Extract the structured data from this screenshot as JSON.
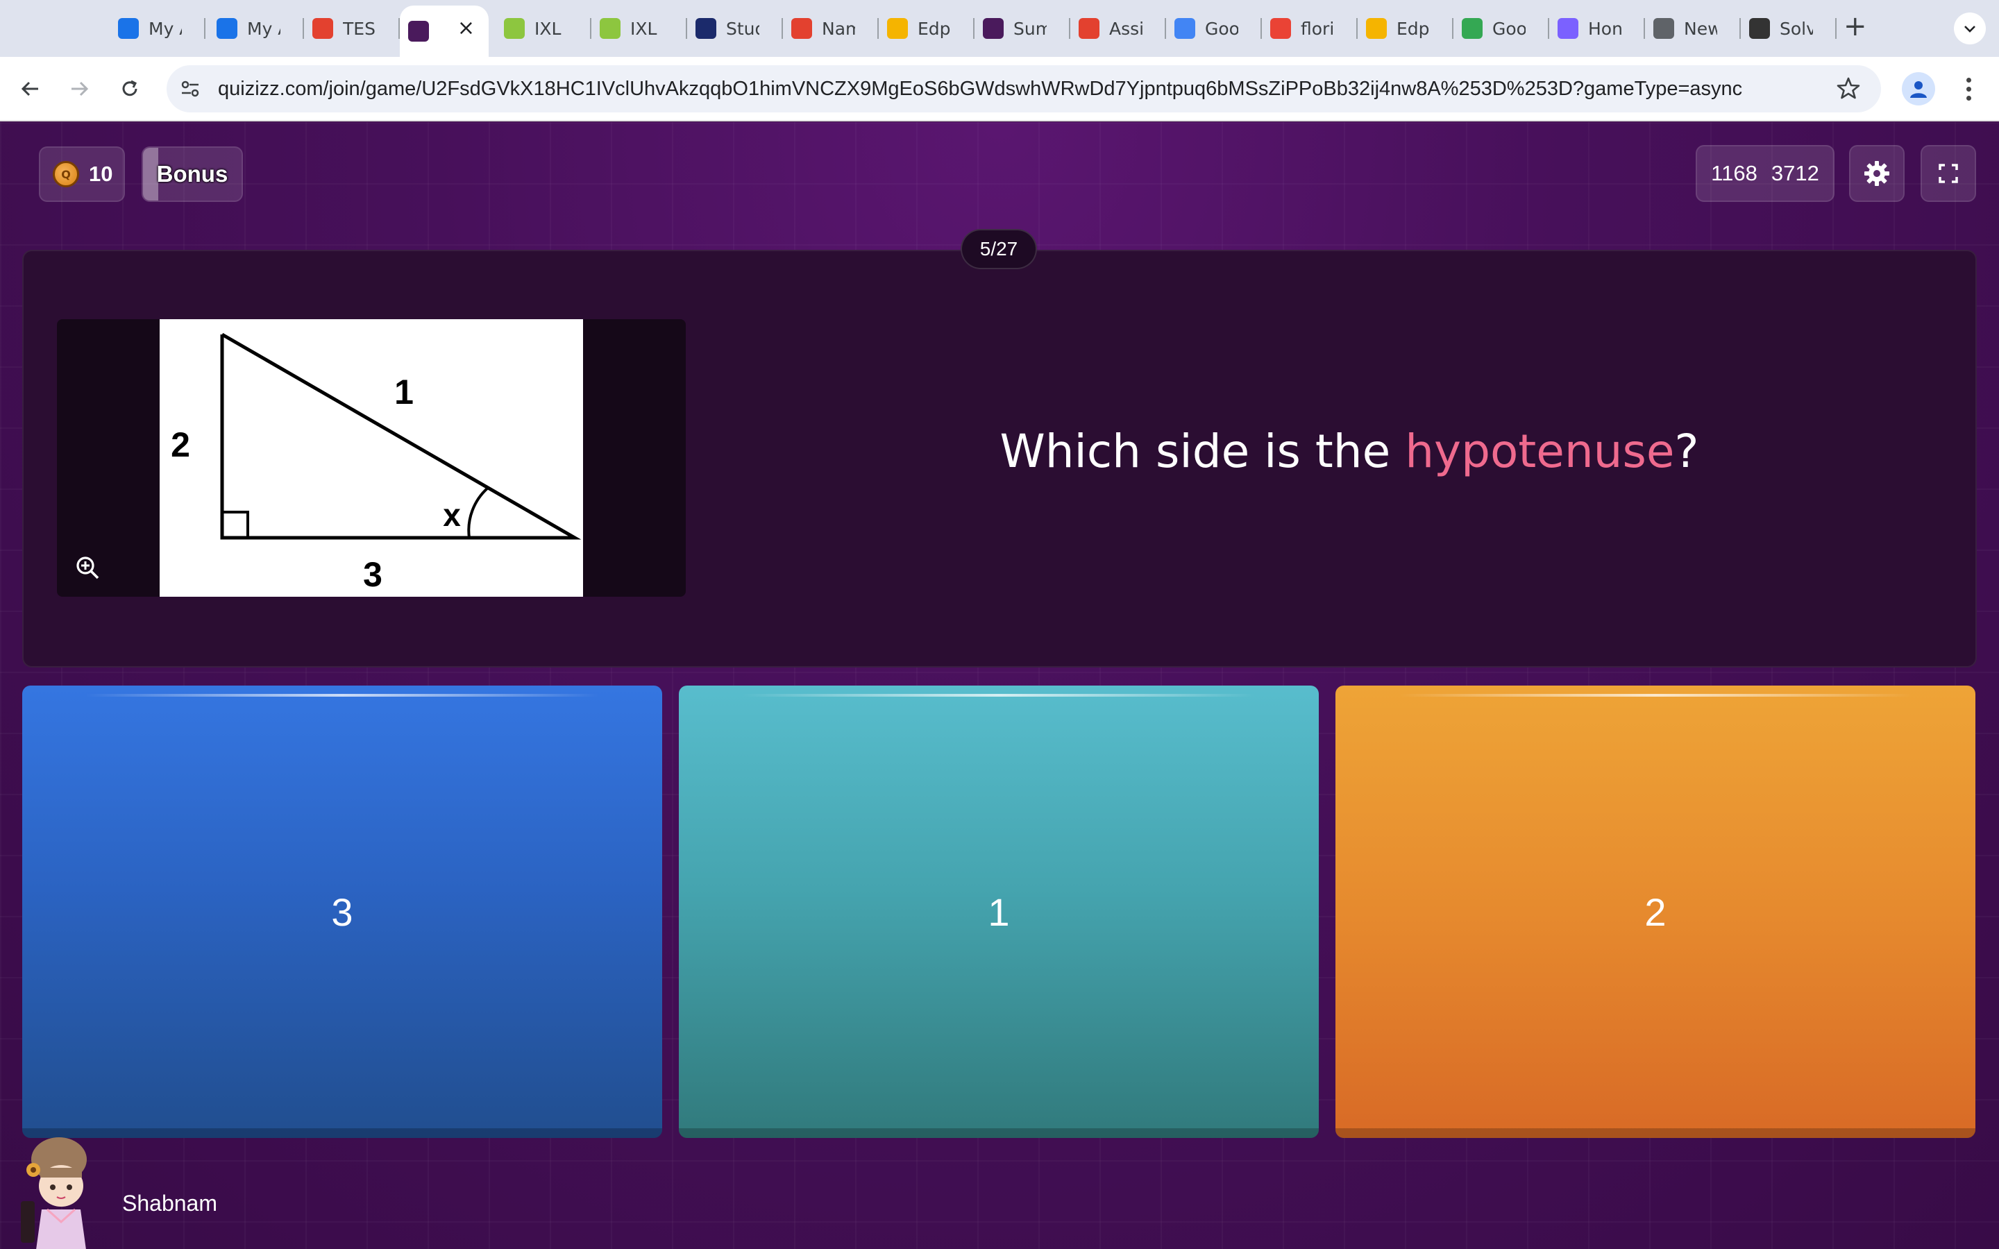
{
  "browser": {
    "tabs": [
      {
        "label": "My A",
        "icon": "cloud-icon",
        "color": "#1a73e8"
      },
      {
        "label": "My A",
        "icon": "cloud-icon",
        "color": "#1a73e8"
      },
      {
        "label": "TES",
        "icon": "canvas-icon",
        "color": "#e3412f"
      },
      {
        "label": "",
        "icon": "quizizz-icon",
        "color": "#4a1a5c",
        "active": true
      },
      {
        "label": "IXL",
        "icon": "ixl-icon",
        "color": "#8dc63f"
      },
      {
        "label": "IXL",
        "icon": "ixl-icon",
        "color": "#8dc63f"
      },
      {
        "label": "Stud",
        "icon": "studio-icon",
        "color": "#1b2a6b"
      },
      {
        "label": "Nam",
        "icon": "canvas-icon",
        "color": "#e3412f"
      },
      {
        "label": "Edp",
        "icon": "edpuzzle-icon",
        "color": "#f5b400"
      },
      {
        "label": "Sum",
        "icon": "quizizz-icon",
        "color": "#4a1a5c"
      },
      {
        "label": "Assi",
        "icon": "canvas-icon",
        "color": "#e3412f"
      },
      {
        "label": "Goo",
        "icon": "google-translate-icon",
        "color": "#4285f4"
      },
      {
        "label": "flori",
        "icon": "google-icon",
        "color": "#ea4335"
      },
      {
        "label": "Edp",
        "icon": "edpuzzle-icon",
        "color": "#f5b400"
      },
      {
        "label": "Goo",
        "icon": "google-lens-icon",
        "color": "#34a853"
      },
      {
        "label": "Hon",
        "icon": "hex-icon",
        "color": "#7b61ff"
      },
      {
        "label": "New",
        "icon": "chrome-icon",
        "color": "#5f6368"
      },
      {
        "label": "Solv",
        "icon": "panda-icon",
        "color": "#333333"
      }
    ],
    "url": "quizizz.com/join/game/U2FsdGVkX18HC1IVclUhvAkzqqbO1himVNCZX9MgEoS6bGWdswhWRwDd7Yjpntpuq6bMSsZiPPoBb32ij4nw8A%253D%253D?gameType=async"
  },
  "game": {
    "powerups_count": "10",
    "bonus_label": "Bonus",
    "score_left": "1168",
    "score_right": "3712",
    "question_counter": "5/27",
    "question_prefix": "Which side is the ",
    "question_highlight": "hypotenuse",
    "question_suffix": "?",
    "diagram_labels": {
      "top": "1",
      "left": "2",
      "bottom": "3",
      "angle": "x"
    },
    "answers": [
      {
        "label": "3",
        "color": "#2b63c2"
      },
      {
        "label": "1",
        "color": "#45a4af"
      },
      {
        "label": "2",
        "color": "#e68a2e"
      }
    ],
    "player_name": "Shabnam",
    "highlight_color": "#ef6a8e"
  }
}
